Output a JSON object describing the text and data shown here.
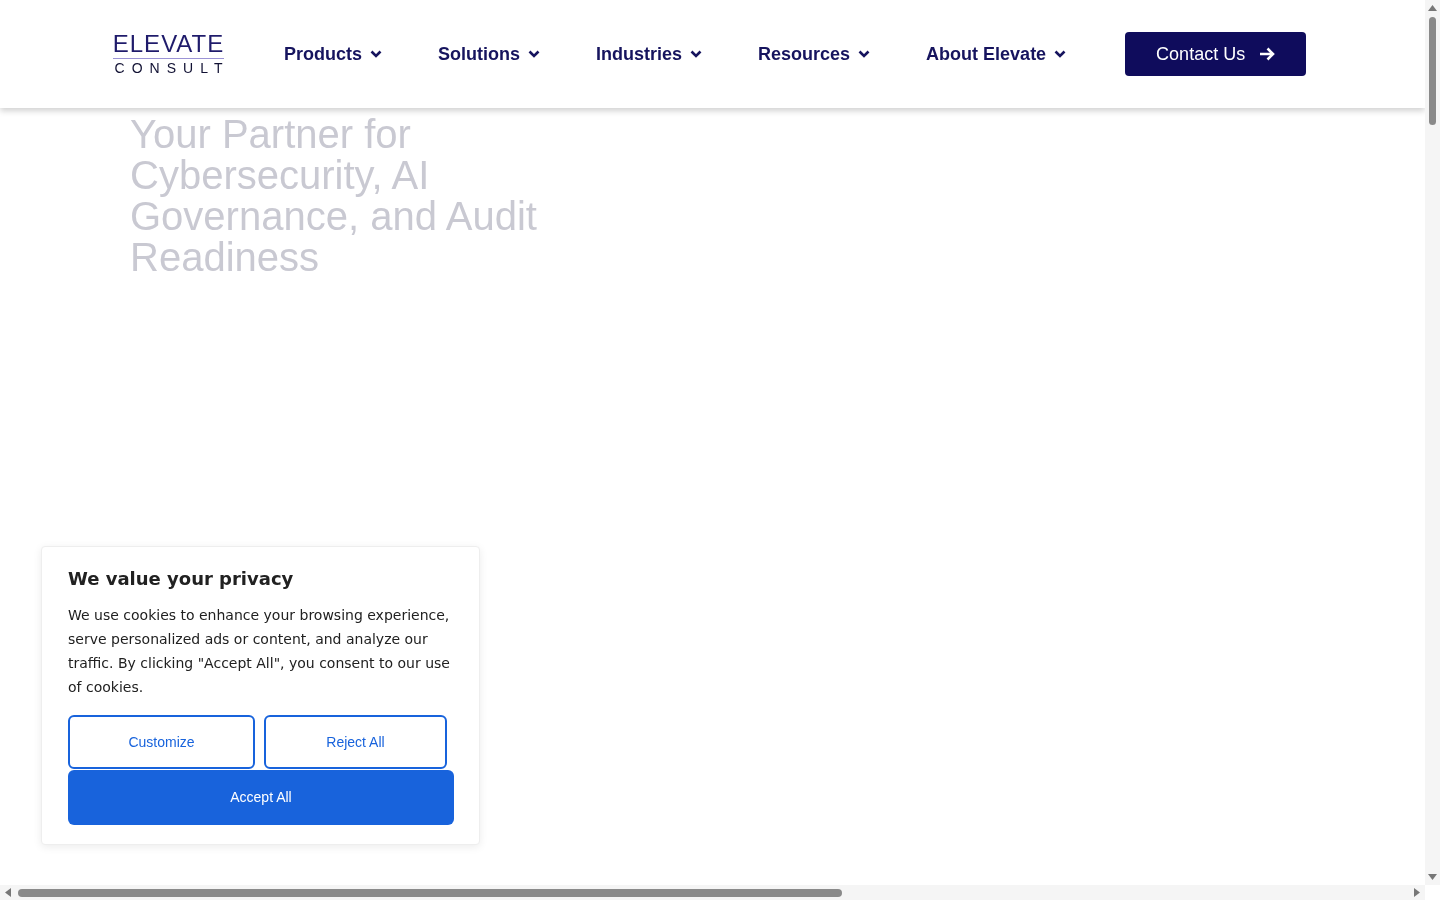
{
  "header": {
    "logo": {
      "word": "ELEVATE",
      "sub": "CONSULT"
    },
    "nav": [
      {
        "label": "Products",
        "dropdown": true
      },
      {
        "label": "Solutions",
        "dropdown": true
      },
      {
        "label": "Industries",
        "dropdown": true
      },
      {
        "label": "Resources",
        "dropdown": true
      },
      {
        "label": "About Elevate",
        "dropdown": true
      }
    ],
    "cta": "Contact Us"
  },
  "hero": {
    "heading": "Your Partner for Cybersecurity, AI Governance, and Audit Readiness"
  },
  "cookie_banner": {
    "title": "We value your privacy",
    "body": "We use cookies to enhance your browsing experience, serve personalized ads or content, and analyze our traffic. By clicking \"Accept All\", you consent to our use of cookies.",
    "buttons": [
      {
        "label": "Customize",
        "kind": "outline"
      },
      {
        "label": "Reject All",
        "kind": "outline"
      },
      {
        "label": "Accept All",
        "kind": "primary"
      }
    ]
  }
}
